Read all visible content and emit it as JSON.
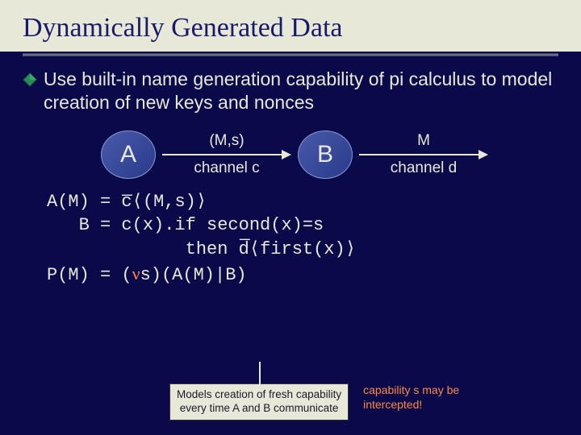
{
  "title": "Dynamically Generated Data",
  "bullet": "Use built-in name generation capability of pi calculus to model creation of new keys and nonces",
  "diagram": {
    "nodeA": "A",
    "nodeB": "B",
    "edge1_top": "(M,s)",
    "edge1_bottom": "channel c",
    "edge2_top": "M",
    "edge2_bottom": "channel d"
  },
  "code": {
    "l1a": "A(M) = c̅⟨(M,s)⟩",
    "l2a": "   B = c(x).if second(x)=s",
    "l3a": "             then d̅⟨first(x)⟩",
    "l4a": "P(M) = (",
    "l4nu": "ν",
    "l4b": "s)(A(M)|B)"
  },
  "callout": {
    "line1": "Models creation of fresh capability",
    "line2": "every time A and B communicate"
  },
  "note": "capability s may be intercepted!"
}
